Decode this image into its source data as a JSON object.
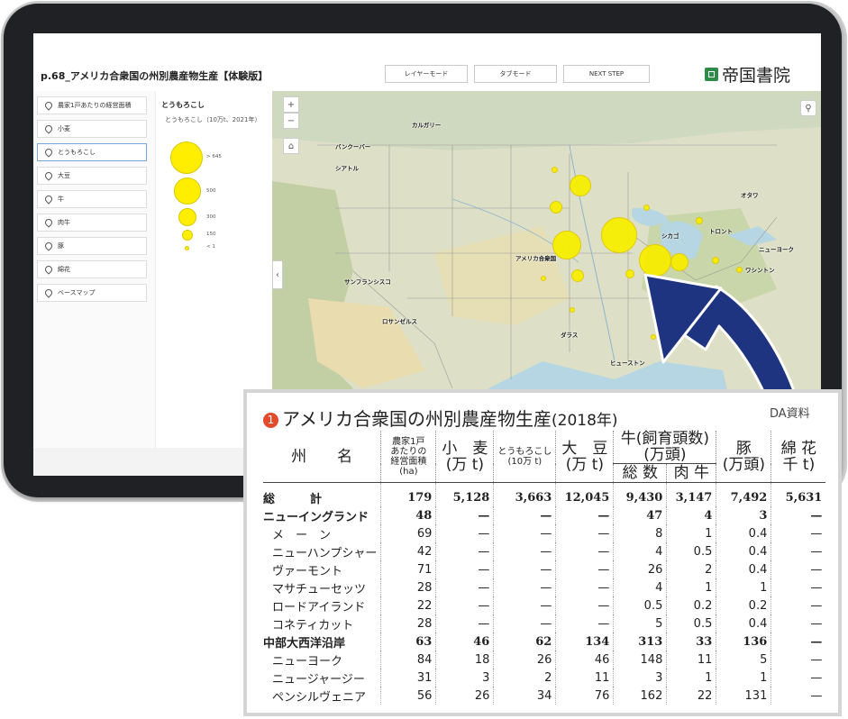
{
  "app": {
    "page_title": "p.68_アメリカ合衆国の州別農産物生産【体験版】",
    "buttons": [
      "レイヤーモード",
      "タブモード",
      "NEXT STEP"
    ],
    "logo_text": "帝国書院",
    "logo_color": "#2e8b4a"
  },
  "sidebar": {
    "items": [
      {
        "label": "農家1戸あたりの経営面積"
      },
      {
        "label": "小麦"
      },
      {
        "label": "とうもろこし",
        "active": true
      },
      {
        "label": "大豆"
      },
      {
        "label": "牛"
      },
      {
        "label": "肉牛"
      },
      {
        "label": "豚"
      },
      {
        "label": "綿花"
      },
      {
        "label": "ベースマップ"
      }
    ]
  },
  "legend": {
    "heading": "とうもろこし",
    "subtitle": "とうもろこし（10万t、2021年）",
    "levels": [
      "> 645",
      "500",
      "300",
      "150",
      "< 1"
    ],
    "dot_color": "#ffee00"
  },
  "map": {
    "controls": {
      "zoom_in": "+",
      "zoom_out": "−",
      "home": "⌂",
      "search": "⚲"
    },
    "cities": [
      "カルガリー",
      "バンクーバー",
      "シアトル",
      "オタワ",
      "トロント",
      "シカゴ",
      "ニューヨーク",
      "ワシントン",
      "アメリカ合衆国",
      "サンフランシスコ",
      "ロサンゼルス",
      "ダラス",
      "ヒューストン"
    ]
  },
  "inset": {
    "badge": "1",
    "title": "アメリカ合衆国の州別農産物生産",
    "year": "(2018年)",
    "source": "DA資料",
    "headers": {
      "state": "州　　名",
      "farm": [
        "農家1戸",
        "あたりの",
        "経営面積",
        "(ha)"
      ],
      "wheat": [
        "小　麦",
        "(万 t)"
      ],
      "corn": [
        "とうもろこし",
        "(10万 t)"
      ],
      "soy": [
        "大　豆",
        "(万 t)"
      ],
      "cattle_group": [
        "牛(飼育頭数)",
        "(万頭)"
      ],
      "cattle_total": "総 数",
      "cattle_beef": "肉 牛",
      "pig": [
        "豚",
        "(万頭)"
      ],
      "cotton": [
        "綿 花",
        "千 t)"
      ]
    },
    "rows": [
      {
        "name": "総　　　計",
        "bold": true,
        "cells": [
          "179",
          "5,128",
          "3,663",
          "12,045",
          "9,430",
          "3,147",
          "7,492",
          "5,631"
        ]
      },
      {
        "name": "ニューイングランド",
        "bold": true,
        "cells": [
          "48",
          "—",
          "—",
          "—",
          "47",
          "4",
          "3",
          "—"
        ]
      },
      {
        "name": "メ　ー　ン",
        "bold": false,
        "cells": [
          "69",
          "—",
          "—",
          "—",
          "8",
          "1",
          "0.4",
          "—"
        ]
      },
      {
        "name": "ニューハンプシャー",
        "bold": false,
        "cells": [
          "42",
          "—",
          "—",
          "—",
          "4",
          "0.5",
          "0.4",
          "—"
        ]
      },
      {
        "name": "ヴァーモント",
        "bold": false,
        "cells": [
          "71",
          "—",
          "—",
          "—",
          "26",
          "2",
          "0.4",
          "—"
        ]
      },
      {
        "name": "マサチューセッツ",
        "bold": false,
        "cells": [
          "28",
          "—",
          "—",
          "—",
          "4",
          "1",
          "1",
          "—"
        ]
      },
      {
        "name": "ロードアイランド",
        "bold": false,
        "cells": [
          "22",
          "—",
          "—",
          "—",
          "0.5",
          "0.2",
          "0.2",
          "—"
        ]
      },
      {
        "name": "コネティカット",
        "bold": false,
        "cells": [
          "28",
          "—",
          "—",
          "—",
          "5",
          "0.5",
          "0.4",
          "—"
        ]
      },
      {
        "name": "中部大西洋沿岸",
        "bold": true,
        "cells": [
          "63",
          "46",
          "62",
          "134",
          "313",
          "33",
          "136",
          "—"
        ]
      },
      {
        "name": "ニューヨーク",
        "bold": false,
        "cells": [
          "84",
          "18",
          "26",
          "46",
          "148",
          "11",
          "5",
          "—"
        ]
      },
      {
        "name": "ニュージャージー",
        "bold": false,
        "cells": [
          "31",
          "3",
          "2",
          "11",
          "3",
          "1",
          "1",
          "—"
        ]
      },
      {
        "name": "ペンシルヴェニア",
        "bold": false,
        "cells": [
          "56",
          "26",
          "34",
          "76",
          "162",
          "22",
          "131",
          "—"
        ]
      }
    ]
  },
  "colors": {
    "arrow": "#1f3480",
    "accent_badge": "#e24a2c",
    "map_dot": "#f7ee00"
  }
}
